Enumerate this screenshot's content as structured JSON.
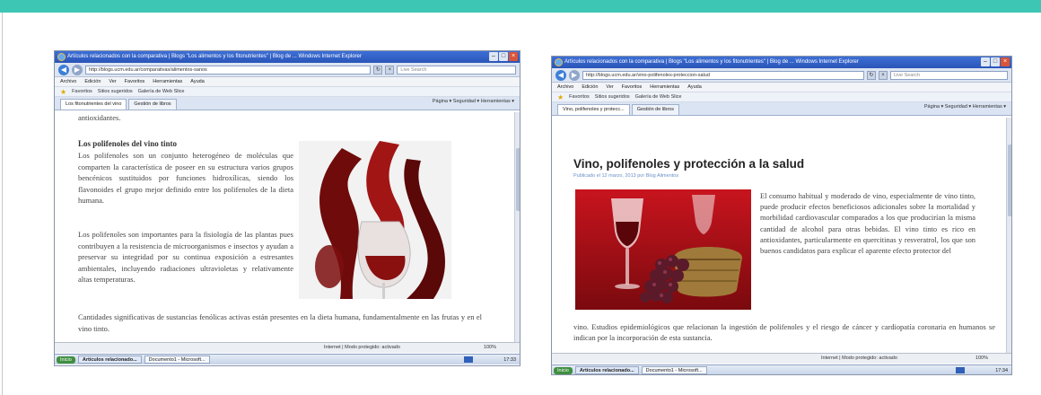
{
  "left_window": {
    "title": "Artículos relacionados con la comparativa | Blogs \"Los alimentos y los fitonutrientes\" | Blog de ... Windows Internet Explorer",
    "address": "http://blogs.ucm.edu.ar/comparativas/alimentos-sanos",
    "search_placeholder": "Live Search",
    "menu": [
      "Archivo",
      "Edición",
      "Ver",
      "Favoritos",
      "Herramientas",
      "Ayuda"
    ],
    "favorites": [
      "Favoritos",
      "Sitios sugeridos",
      "Galería de Web Slice"
    ],
    "tabs": [
      "Los fitonutrientes del vino",
      "Gestión de libros"
    ],
    "commands": "Página ▾  Seguridad ▾  Herramientas ▾",
    "content": {
      "top_line": "antioxidantes.",
      "heading": "Los polifenoles del vino tinto",
      "para1": "Los polifenoles son un conjunto heterogéneo de moléculas que comparten la característica de poseer en su estructura varios grupos bencénicos sustituidos por funciones hidroxílicas, siendo los flavonoides el grupo mejor definido entre los polifenoles de la dieta humana.",
      "para2": "Los polifenoles son importantes para la fisiología de las plantas pues contribuyen a la resistencia de microorganismos e insectos y ayudan a preservar su integridad por su continua exposición a estresantes ambientales, incluyendo radiaciones ultravioletas y relativamente altas temperaturas.",
      "para3": "Cantidades significativas de sustancias fenólicas activas están presentes en la dieta humana, fundamentalmente en las frutas y en el vino tinto."
    },
    "status": "Internet | Modo protegido: activado",
    "zoom": "100%",
    "taskbar": {
      "start": "Inicio",
      "items": [
        "Artículos relacionado...",
        "Documento1 - Microsoft..."
      ],
      "clock": "17:33"
    }
  },
  "right_window": {
    "title": "Artículos relacionados con la comparativa | Blogs \"Los alimentos y los fitonutrientes\" | Blog de ... Windows Internet Explorer",
    "address": "http://blogs.ucm.edu.ar/vino-polifenoles-proteccion-salud",
    "search_placeholder": "Live Search",
    "menu": [
      "Archivo",
      "Edición",
      "Ver",
      "Favoritos",
      "Herramientas",
      "Ayuda"
    ],
    "favorites": [
      "Favoritos",
      "Sitios sugeridos",
      "Galería de Web Slice"
    ],
    "tabs": [
      "Vino, polifenoles y protecc...",
      "Gestión de libros"
    ],
    "commands": "Página ▾  Seguridad ▾  Herramientas ▾",
    "content": {
      "title": "Vino, polifenoles y protección a la salud",
      "byline": "Publicado el 12 marzo, 2013 por Blog Alimentos",
      "para1": "El consumo habitual y moderado de vino, especialmente de vino tinto, puede producir efectos beneficiosos adicionales sobre la mortalidad y morbilidad cardiovascular comparados a los que producirían la misma cantidad de alcohol para otras bebidas. El vino tinto es rico en antioxidantes, particularmente en quercitinas y resveratrol, los que son buenos candidatos para explicar el aparente efecto protector del",
      "para2": "vino. Estudios epidemiológicos que relacionan la ingestión de polifenoles y el riesgo de cáncer y cardiopatía coronaria en humanos se indican por la incorporación de esta sustancia."
    },
    "status": "Internet | Modo protegido: activado",
    "zoom": "100%",
    "taskbar": {
      "start": "Inicio",
      "items": [
        "Artículos relacionado...",
        "Documento1 - Microsoft..."
      ],
      "clock": "17:34"
    }
  },
  "colors": {
    "accent_rule": "#3ec6b4",
    "ie_titlebar": "#2a55b8",
    "wine_red": "#8a1010"
  },
  "icons": [
    "ie-logo-icon",
    "back-arrow-icon",
    "forward-arrow-icon",
    "favorites-star-icon",
    "home-icon",
    "close-icon"
  ]
}
